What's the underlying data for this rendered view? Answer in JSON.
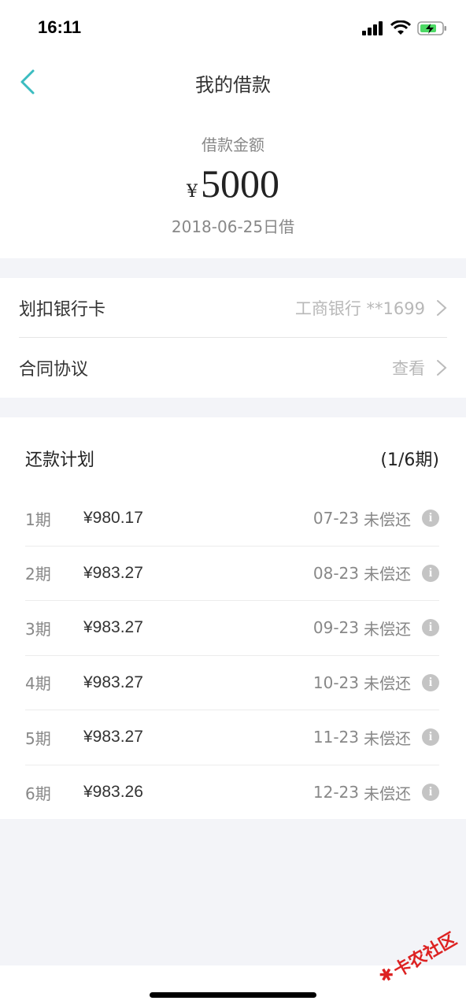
{
  "status_bar": {
    "time": "16:11"
  },
  "nav": {
    "title": "我的借款"
  },
  "summary": {
    "label": "借款金额",
    "currency": "¥",
    "amount": "5000",
    "date": "2018-06-25日借"
  },
  "info": {
    "bank_label": "划扣银行卡",
    "bank_value": "工商银行 **1699",
    "contract_label": "合同协议",
    "contract_value": "查看"
  },
  "plan": {
    "title": "还款计划",
    "count": "(1/6期)",
    "rows": [
      {
        "period": "1期",
        "amount": "¥980.17",
        "date": "07-23",
        "status": "未偿还"
      },
      {
        "period": "2期",
        "amount": "¥983.27",
        "date": "08-23",
        "status": "未偿还"
      },
      {
        "period": "3期",
        "amount": "¥983.27",
        "date": "09-23",
        "status": "未偿还"
      },
      {
        "period": "4期",
        "amount": "¥983.27",
        "date": "10-23",
        "status": "未偿还"
      },
      {
        "period": "5期",
        "amount": "¥983.27",
        "date": "11-23",
        "status": "未偿还"
      },
      {
        "period": "6期",
        "amount": "¥983.26",
        "date": "12-23",
        "status": "未偿还"
      }
    ]
  },
  "watermark": {
    "text": "卡农社区"
  },
  "colors": {
    "accent": "#3bbcc0",
    "background": "#f3f4f8"
  }
}
